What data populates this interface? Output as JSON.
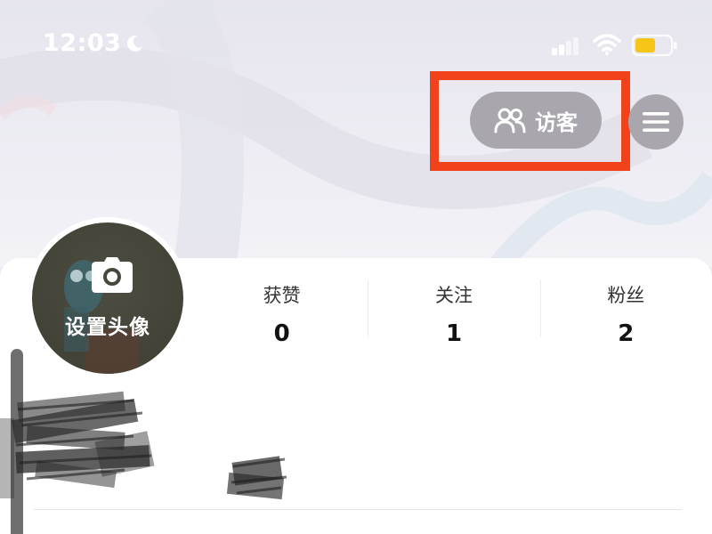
{
  "status_bar": {
    "time": "12:03",
    "icons": [
      "moon-icon",
      "signal-icon",
      "wifi-icon",
      "battery-icon"
    ],
    "battery_color": "#f5c518"
  },
  "header": {
    "visitor_label": "访客",
    "visitor_icon": "people-icon",
    "menu_icon": "hamburger-menu-icon",
    "highlight_color": "#f2421c"
  },
  "profile": {
    "avatar_label": "设置头像",
    "avatar_icon": "camera-icon"
  },
  "stats": [
    {
      "label": "获赞",
      "value": "0"
    },
    {
      "label": "关注",
      "value": "1"
    },
    {
      "label": "粉丝",
      "value": "2"
    }
  ]
}
